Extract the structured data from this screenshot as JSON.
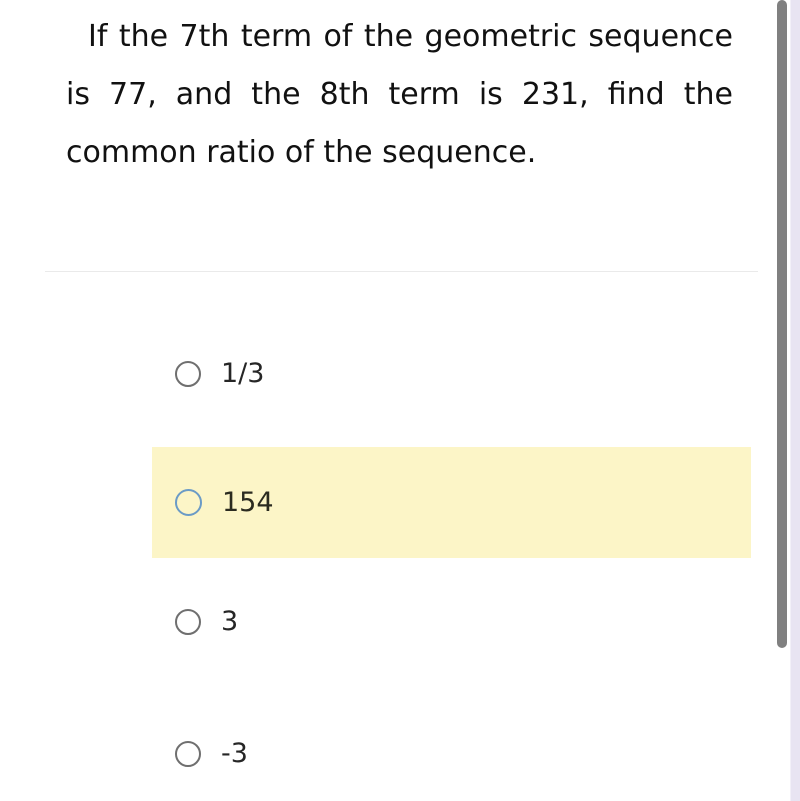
{
  "question": {
    "text": "If the 7th term of the geometric sequence is 77, and the 8th term is 231, find the common ratio of the sequence."
  },
  "options": [
    {
      "label": "1/3",
      "selected": false,
      "highlighted": false,
      "radio_icon": "radio-unselected-icon"
    },
    {
      "label": "154",
      "selected": false,
      "highlighted": true,
      "radio_icon": "radio-unselected-icon"
    },
    {
      "label": "3",
      "selected": false,
      "highlighted": false,
      "radio_icon": "radio-unselected-icon"
    },
    {
      "label": "-3",
      "selected": false,
      "highlighted": false,
      "radio_icon": "radio-unselected-icon"
    }
  ],
  "colors": {
    "highlight_background": "#FCF5C7",
    "highlight_radio_border": "#6b9bc6",
    "radio_border": "#6f6f6f",
    "question_text": "#111111",
    "option_text": "#262626",
    "divider": "#eaeaea",
    "scrollbar_thumb": "#808080",
    "right_strip": "#E8E4F2"
  },
  "scrollbar": {
    "thumb_icon": "scrollbar-thumb"
  }
}
